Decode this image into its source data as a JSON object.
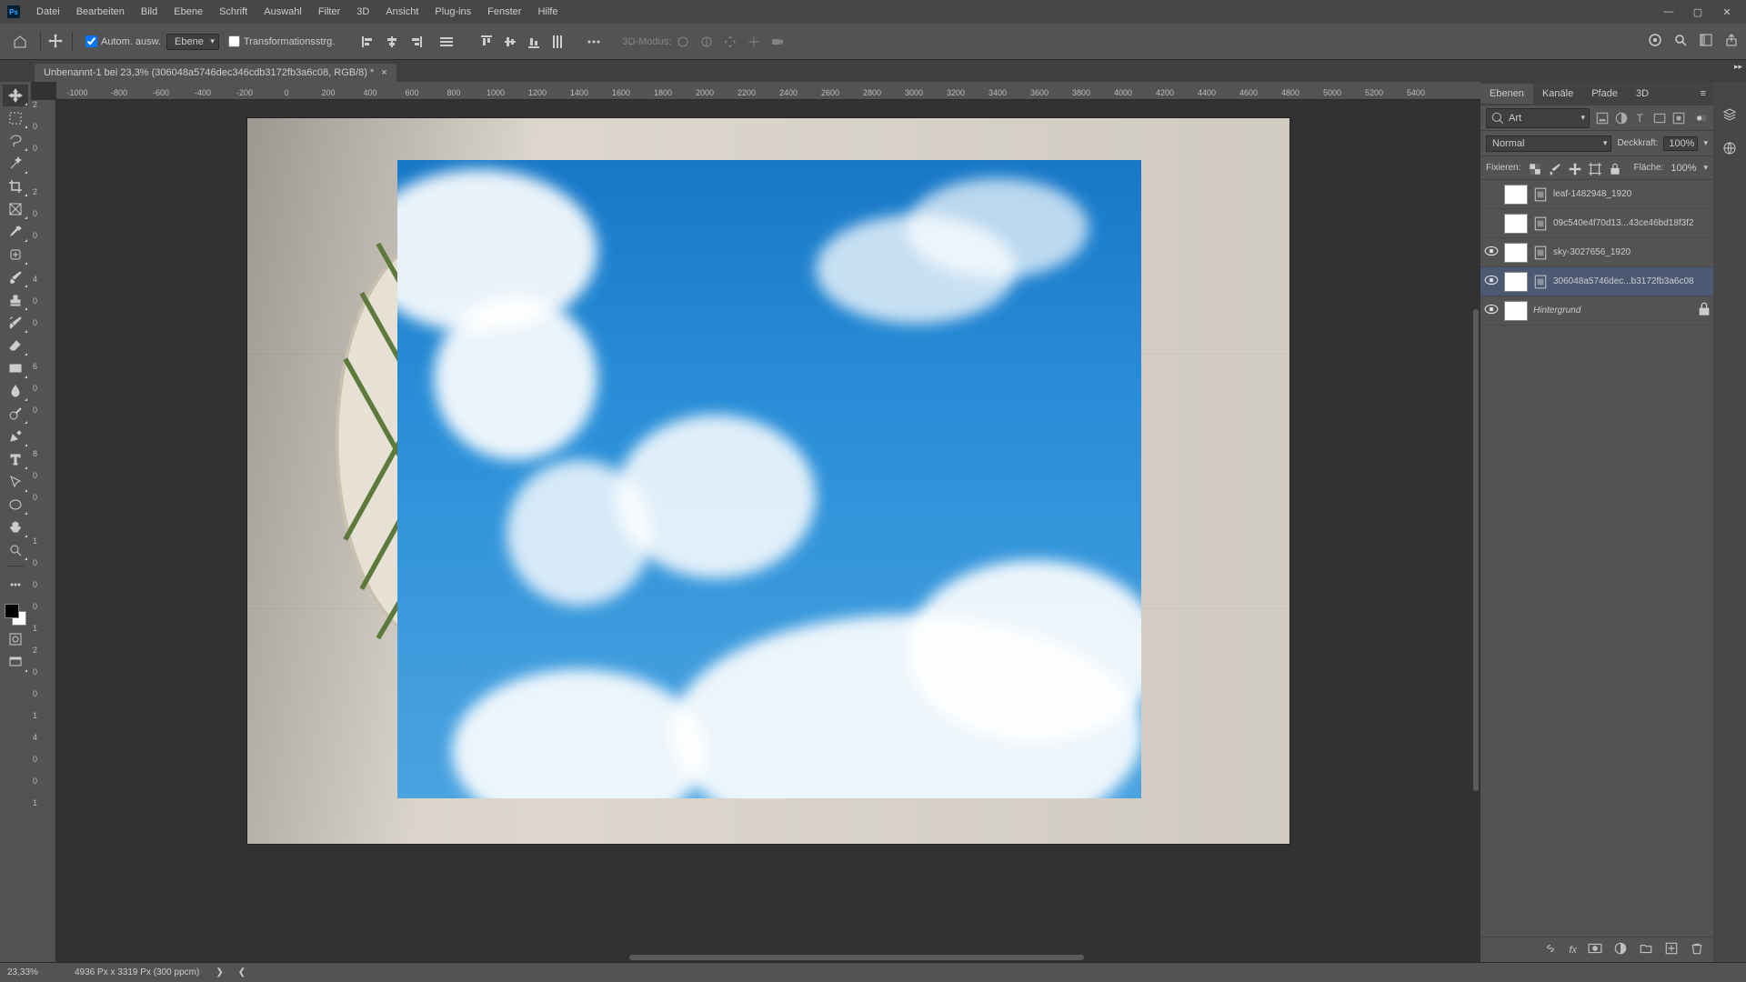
{
  "menu": [
    "Datei",
    "Bearbeiten",
    "Bild",
    "Ebene",
    "Schrift",
    "Auswahl",
    "Filter",
    "3D",
    "Ansicht",
    "Plug-ins",
    "Fenster",
    "Hilfe"
  ],
  "options": {
    "auto_select_label": "Autom. ausw.",
    "auto_select_checked": true,
    "target_dropdown": "Ebene",
    "transform_label": "Transformationsstrg.",
    "transform_checked": false,
    "mode3d_label": "3D-Modus:"
  },
  "document": {
    "tab_title": "Unbenannt-1 bei 23,3% (306048a5746dec346cdb3172fb3a6c08, RGB/8) *"
  },
  "ruler_h": [
    "-1000",
    "-800",
    "-600",
    "-400",
    "-200",
    "0",
    "200",
    "400",
    "600",
    "800",
    "1000",
    "1200",
    "1400",
    "1600",
    "1800",
    "2000",
    "2200",
    "2400",
    "2600",
    "2800",
    "3000",
    "3200",
    "3400",
    "3600",
    "3800",
    "4000",
    "4200",
    "4400",
    "4600",
    "4800",
    "5000",
    "5200",
    "5400"
  ],
  "ruler_v": [
    "2",
    "0",
    "0",
    "",
    "2",
    "0",
    "0",
    "",
    "4",
    "0",
    "0",
    "",
    "6",
    "0",
    "0",
    "",
    "8",
    "0",
    "0",
    "",
    "1",
    "0",
    "0",
    "0",
    "1",
    "2",
    "0",
    "0",
    "1",
    "4",
    "0",
    "0",
    "1"
  ],
  "panels": {
    "tabs": {
      "layers": "Ebenen",
      "channels": "Kanäle",
      "paths": "Pfade",
      "three": "3D"
    },
    "filter_placeholder": "Art",
    "blend_mode": "Normal",
    "opacity_label": "Deckkraft:",
    "opacity_value": "100%",
    "lock_label": "Fixieren:",
    "fill_label": "Fläche:",
    "fill_value": "100%"
  },
  "layers": [
    {
      "visible": false,
      "name": "leaf-1482948_1920",
      "thumb": "th-leaf",
      "smart": true
    },
    {
      "visible": false,
      "name": "09c540e4f70d13...43ce46bd18f3f2",
      "thumb": "th-fr",
      "smart": true
    },
    {
      "visible": true,
      "name": "sky-3027656_1920",
      "thumb": "th-sky",
      "smart": true
    },
    {
      "visible": true,
      "name": "306048a5746dec...b3172fb3a6c08",
      "thumb": "th-wood",
      "smart": true,
      "selected": true
    },
    {
      "visible": true,
      "name": "Hintergrund",
      "thumb": "th-bg",
      "locked": true,
      "italic": true
    }
  ],
  "status": {
    "zoom": "23,33%",
    "docinfo": "4936 Px x 3319 Px (300 ppcm)"
  }
}
